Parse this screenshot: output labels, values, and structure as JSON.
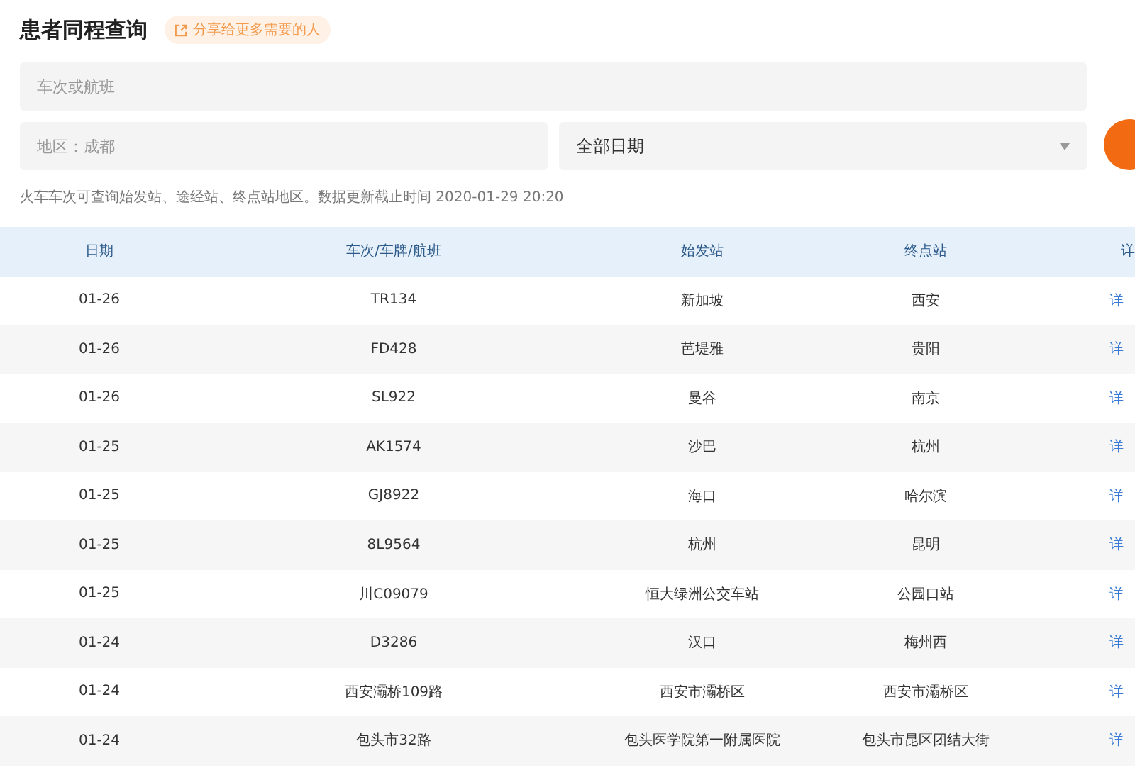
{
  "title": "患者同程查询",
  "share": {
    "label": "分享给更多需要的人"
  },
  "search": {
    "placeholder": "车次或航班"
  },
  "region": {
    "placeholder": "地区：成都"
  },
  "date_select": {
    "value": "全部日期"
  },
  "note": "火车车次可查询始发站、途经站、终点站地区。数据更新截止时间 2020-01-29 20:20",
  "table": {
    "columns": [
      "日期",
      "车次/车牌/航班",
      "始发站",
      "终点站",
      "详"
    ],
    "rows": [
      {
        "date": "01-26",
        "code": "TR134",
        "from": "新加坡",
        "to": "西安",
        "detail": "详"
      },
      {
        "date": "01-26",
        "code": "FD428",
        "from": "芭堤雅",
        "to": "贵阳",
        "detail": "详"
      },
      {
        "date": "01-26",
        "code": "SL922",
        "from": "曼谷",
        "to": "南京",
        "detail": "详"
      },
      {
        "date": "01-25",
        "code": "AK1574",
        "from": "沙巴",
        "to": "杭州",
        "detail": "详"
      },
      {
        "date": "01-25",
        "code": "GJ8922",
        "from": "海口",
        "to": "哈尔滨",
        "detail": "详"
      },
      {
        "date": "01-25",
        "code": "8L9564",
        "from": "杭州",
        "to": "昆明",
        "detail": "详"
      },
      {
        "date": "01-25",
        "code": "川C09079",
        "from": "恒大绿洲公交车站",
        "to": "公园口站",
        "detail": "详"
      },
      {
        "date": "01-24",
        "code": "D3286",
        "from": "汉口",
        "to": "梅州西",
        "detail": "详"
      },
      {
        "date": "01-24",
        "code": "西安灞桥109路",
        "from": "西安市灞桥区",
        "to": "西安市灞桥区",
        "detail": "详"
      },
      {
        "date": "01-24",
        "code": "包头市32路",
        "from": "包头医学院第一附属医院",
        "to": "包头市昆区团结大街",
        "detail": "详"
      }
    ]
  }
}
